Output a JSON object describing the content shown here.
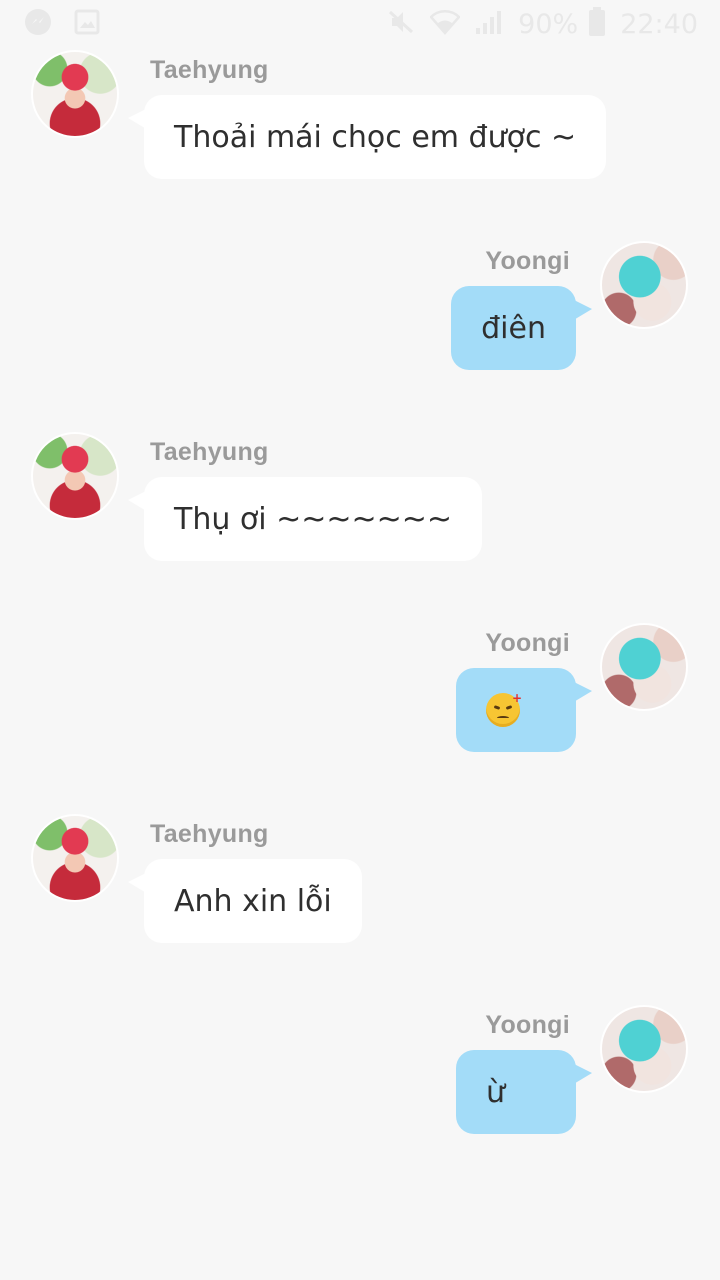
{
  "status_bar": {
    "battery_percent": "90%",
    "time": "22:40"
  },
  "messages": [
    {
      "sender": "Taehyung",
      "side": "left",
      "text": "Thoải mái chọc em được ~",
      "avatar": "avatar-taehyung"
    },
    {
      "sender": "Yoongi",
      "side": "right",
      "text": "điên",
      "avatar": "avatar-yoongi"
    },
    {
      "sender": "Taehyung",
      "side": "left",
      "text": "Thụ ơi ~~~~~~~",
      "avatar": "avatar-taehyung"
    },
    {
      "sender": "Yoongi",
      "side": "right",
      "text": "",
      "emoji": "angry-face-icon",
      "avatar": "avatar-yoongi"
    },
    {
      "sender": "Taehyung",
      "side": "left",
      "text": "Anh xin lỗi",
      "avatar": "avatar-taehyung"
    },
    {
      "sender": "Yoongi",
      "side": "right",
      "text": "ừ",
      "avatar": "avatar-yoongi"
    }
  ]
}
